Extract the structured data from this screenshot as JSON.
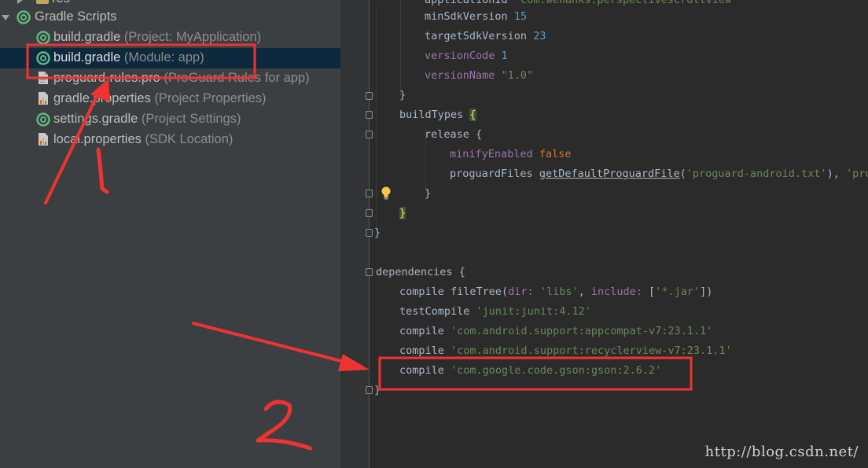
{
  "project_tree": {
    "partial_item": {
      "label": "res"
    },
    "group": {
      "label": "Gradle Scripts"
    },
    "items": [
      {
        "label": "build.gradle",
        "hint": "(Project: MyApplication)",
        "icon": "gradle-icon"
      },
      {
        "label": "build.gradle",
        "hint": "(Module: app)",
        "icon": "gradle-icon",
        "selected": true
      },
      {
        "label": "proguard-rules.pro",
        "hint": "(ProGuard Rules for app)",
        "icon": "file-icon"
      },
      {
        "label": "gradle.properties",
        "hint": "(Project Properties)",
        "icon": "properties-icon"
      },
      {
        "label": "settings.gradle",
        "hint": "(Project Settings)",
        "icon": "gradle-icon"
      },
      {
        "label": "local.properties",
        "hint": "(SDK Location)",
        "icon": "properties-icon"
      }
    ]
  },
  "editor": {
    "line0": {
      "name": "applicationId",
      "value": "\"com.wehanks.perspectivescrollview\""
    },
    "line1": {
      "name": "minSdkVersion",
      "value": "15"
    },
    "line2": {
      "name": "targetSdkVersion",
      "value": "23"
    },
    "line3": {
      "name": "versionCode",
      "value": "1"
    },
    "line4": {
      "name": "versionName",
      "value": "\"1.0\""
    },
    "line5": {
      "text": "}"
    },
    "line6": {
      "name": "buildTypes",
      "brace": "{"
    },
    "line7": {
      "name": "release",
      "brace": "{"
    },
    "line8": {
      "name": "minifyEnabled",
      "value": "false"
    },
    "line9": {
      "name": "proguardFiles",
      "fn": "getDefaultProguardFile",
      "open": "(",
      "arg": "'proguard-android.txt'",
      "close": "), ",
      "arg2": "'prog"
    },
    "line10": {
      "text": "}"
    },
    "line11": {
      "text": "}"
    },
    "line12": {
      "text": "}"
    },
    "line13": {
      "name": "dependencies",
      "brace": "{"
    },
    "line14": {
      "name": "compile fileTree(",
      "p1": "dir:",
      "v1": "'libs'",
      "sep": ", ",
      "p2": "include:",
      "v2a": "[",
      "v2": "'*.jar'",
      "v2b": "])"
    },
    "line15": {
      "name": "testCompile ",
      "value": "'junit:junit:4.12'"
    },
    "line16": {
      "name": "compile ",
      "value": "'com.android.support:appcompat-v7:23.1.1'"
    },
    "line17": {
      "name": "compile ",
      "value": "'com.android.support:recyclerview-v7:23.1.1'"
    },
    "line18": {
      "name": "compile ",
      "value": "'com.google.code.gson:gson:2.6.2'"
    },
    "line19": {
      "text": "}"
    }
  },
  "watermark": "http://blog.csdn.net/",
  "annotations": {
    "label1": "1",
    "label2": "2",
    "color": "#ff3b30"
  }
}
